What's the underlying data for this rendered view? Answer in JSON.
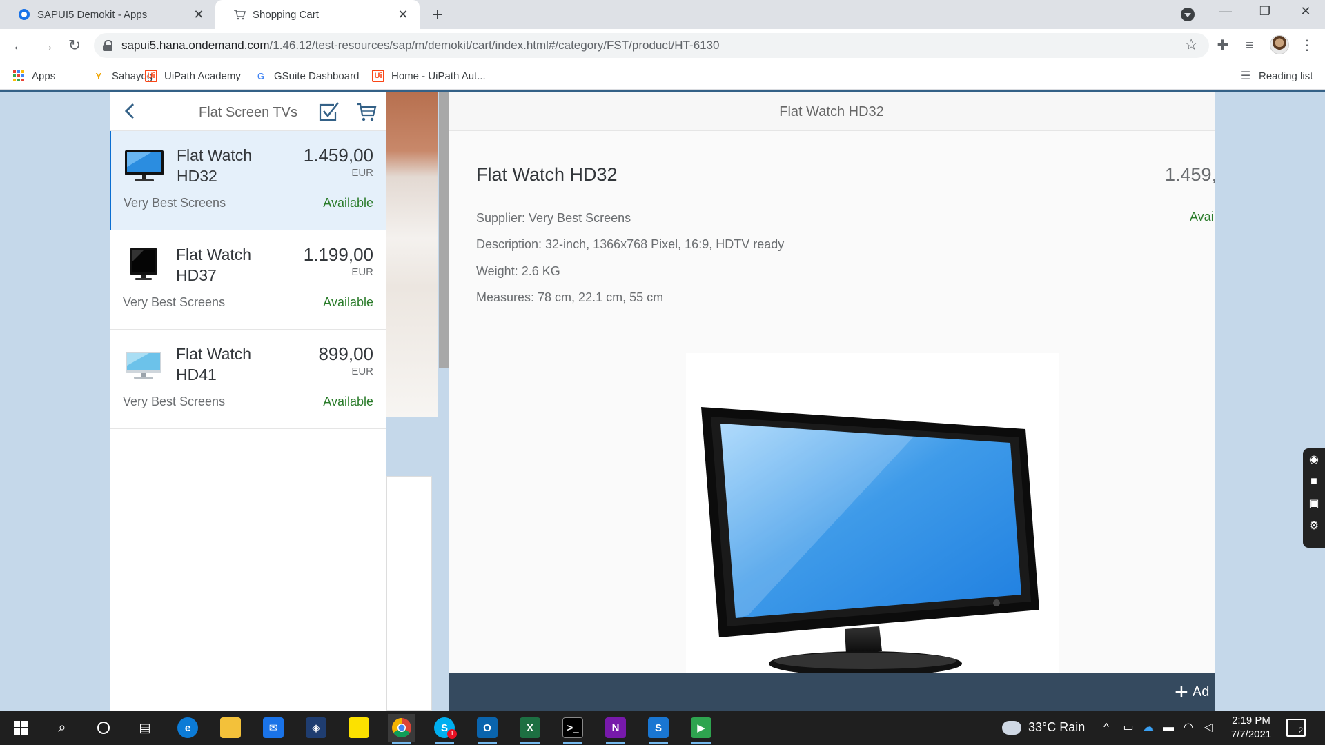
{
  "browser": {
    "tabs": [
      {
        "title": "SAPUI5 Demokit - Apps",
        "active": false
      },
      {
        "title": "Shopping Cart",
        "active": true
      }
    ],
    "url_domain": "sapui5.hana.ondemand.com",
    "url_path": "/1.46.12/test-resources/sap/m/demokit/cart/index.html#/category/FST/product/HT-6130",
    "bookmarks": [
      {
        "label": "Apps",
        "icon": "apps-grid-icon"
      },
      {
        "label": "Sahayog",
        "icon": "sahayog-icon"
      },
      {
        "label": "UiPath Academy",
        "icon": "uipath-icon"
      },
      {
        "label": "GSuite Dashboard",
        "icon": "google-icon"
      },
      {
        "label": "Home - UiPath Aut...",
        "icon": "uipath-icon"
      }
    ],
    "reading_list": "Reading list"
  },
  "master": {
    "title": "Flat Screen TVs",
    "products": [
      {
        "name": "Flat Watch HD32",
        "price": "1.459,00",
        "currency": "EUR",
        "supplier": "Very Best Screens",
        "status": "Available",
        "selected": true
      },
      {
        "name": "Flat Watch HD37",
        "price": "1.199,00",
        "currency": "EUR",
        "supplier": "Very Best Screens",
        "status": "Available",
        "selected": false
      },
      {
        "name": "Flat Watch HD41",
        "price": "899,00",
        "currency": "EUR",
        "supplier": "Very Best Screens",
        "status": "Available",
        "selected": false
      }
    ]
  },
  "detail": {
    "header": "Flat Watch HD32",
    "title": "Flat Watch HD32",
    "price": "1.459,",
    "status": "Avai",
    "attributes": [
      "Supplier: Very Best Screens",
      "Description: 32-inch, 1366x768 Pixel, 16:9, HDTV ready",
      "Weight: 2.6 KG",
      "Measures: 78 cm, 22.1 cm, 55 cm"
    ],
    "add_button": "Ad"
  },
  "taskbar": {
    "weather": "33°C  Rain",
    "time": "2:19 PM",
    "date": "7/7/2021",
    "notifications": "2",
    "skype_badge": "1"
  },
  "colors": {
    "available": "#2b7c2b",
    "selection": "#e5f0fa",
    "shell": "#354a5f",
    "page_bg": "#c5d8ea"
  }
}
